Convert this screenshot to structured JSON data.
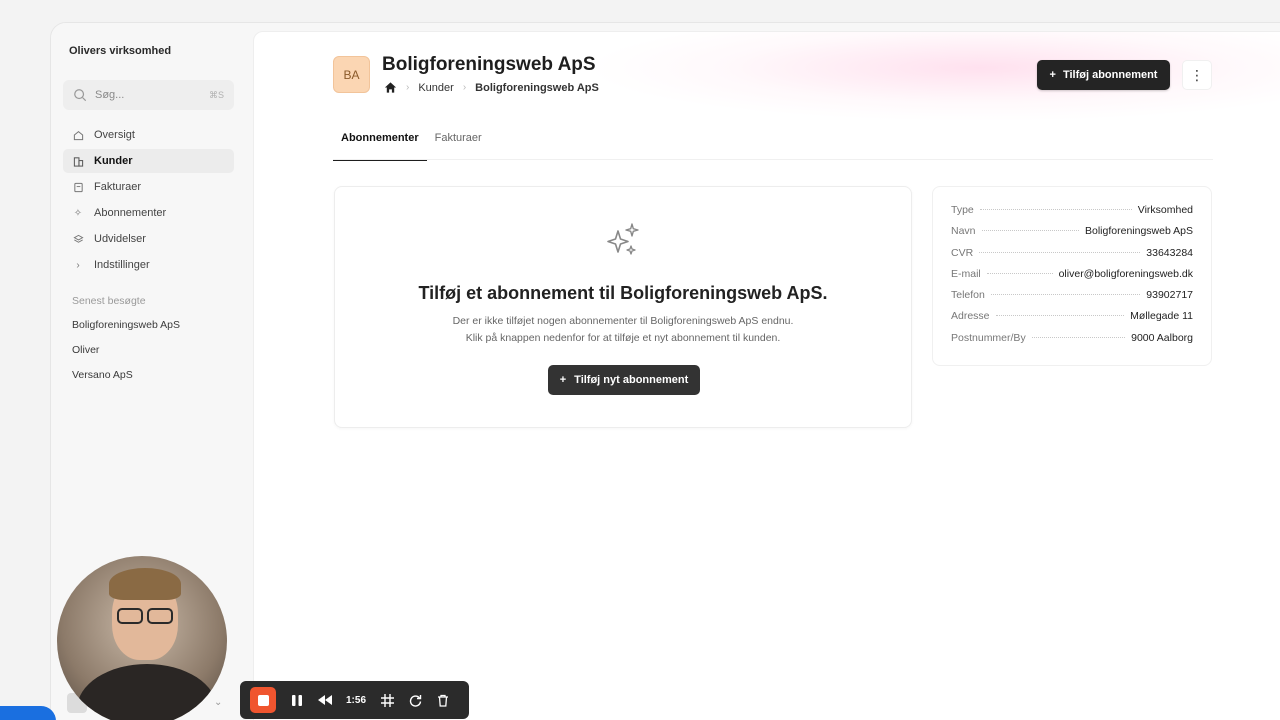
{
  "sidebar": {
    "org_name": "Olivers virksomhed",
    "search_placeholder": "Søg...",
    "search_shortcut": "⌘S",
    "nav": [
      {
        "label": "Oversigt",
        "icon": "home-icon"
      },
      {
        "label": "Kunder",
        "icon": "building-icon"
      },
      {
        "label": "Fakturaer",
        "icon": "invoice-icon"
      },
      {
        "label": "Abonnementer",
        "icon": "sparkle-icon"
      },
      {
        "label": "Udvidelser",
        "icon": "layers-icon"
      },
      {
        "label": "Indstillinger",
        "icon": "chevron-right-icon"
      }
    ],
    "recent_title": "Senest besøgte",
    "recent": [
      "Boligforeningsweb ApS",
      "Oliver",
      "Versano ApS"
    ]
  },
  "header": {
    "badge": "BA",
    "title": "Boligforeningsweb ApS",
    "breadcrumb": [
      "Kunder",
      "Boligforeningsweb ApS"
    ],
    "add_subscription_label": "Tilføj abonnement",
    "more_label": "⋮"
  },
  "tabs": [
    "Abonnementer",
    "Fakturaer"
  ],
  "empty_state": {
    "title": "Tilføj et abonnement til Boligforeningsweb ApS.",
    "desc_line1": "Der er ikke tilføjet nogen abonnementer til Boligforeningsweb ApS endnu.",
    "desc_line2": "Klik på knappen nedenfor for at tilføje et nyt abonnement til kunden.",
    "button_label": "Tilføj nyt abonnement"
  },
  "details": [
    {
      "key": "Type",
      "value": "Virksomhed"
    },
    {
      "key": "Navn",
      "value": "Boligforeningsweb ApS"
    },
    {
      "key": "CVR",
      "value": "33643284"
    },
    {
      "key": "E-mail",
      "value": "oliver@boligforeningsweb.dk"
    },
    {
      "key": "Telefon",
      "value": "93902717"
    },
    {
      "key": "Adresse",
      "value": "Møllegade 11"
    },
    {
      "key": "Postnummer/By",
      "value": "9000 Aalborg"
    }
  ],
  "recorder": {
    "time": "1:56"
  },
  "colors": {
    "primary_button": "#242424",
    "badge_bg": "#fbd6b3",
    "record_button": "#f0552f"
  }
}
